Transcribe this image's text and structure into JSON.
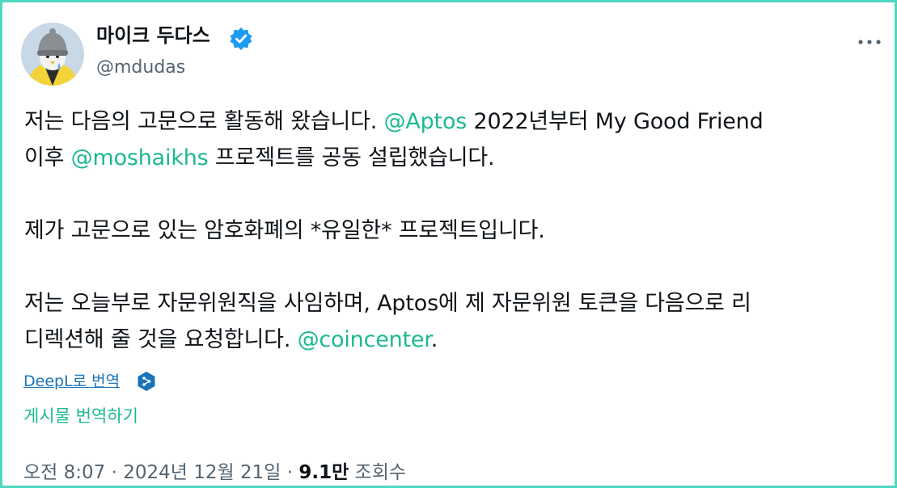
{
  "author": {
    "display_name": "마이크 두다스",
    "handle": "@mdudas",
    "verified_icon": "verified-badge-icon",
    "avatar_icon": "avatar"
  },
  "more_icon": "more-options-icon",
  "tweet": {
    "line1_a": "저는 다음의 고문으로 활동해 왔습니다. ",
    "line1_mention": "@Aptos",
    "line1_b": " 2022년부터 My Good Friend",
    "line2_a": "이후 ",
    "line2_mention": "@moshaikhs",
    "line2_b": " 프로젝트를 공동 설립했습니다.",
    "line3": "제가 고문으로 있는 암호화폐의 *유일한* 프로젝트입니다.",
    "line4": "저는 오늘부로 자문위원직을 사임하며, Aptos에 제 자문위원 토큰을 다음으로 리",
    "line5_a": "디렉션해 줄 것을 요청합니다. ",
    "line5_mention": "@coincenter",
    "line5_b": "."
  },
  "translation": {
    "deepl_label": "DeepL로 번역",
    "deepl_icon": "deepl-icon",
    "translate_post_label": "게시물 번역하기"
  },
  "meta": {
    "time": "오전 8:07",
    "sep1": " · ",
    "date": "2024년 12월 21일",
    "sep2": " · ",
    "views": "9.1만",
    "views_label": " 조회수"
  },
  "colors": {
    "accent": "#1db991",
    "link": "#1a73b8",
    "verified": "#1d9bf0",
    "frame": "#4fd8c0"
  }
}
